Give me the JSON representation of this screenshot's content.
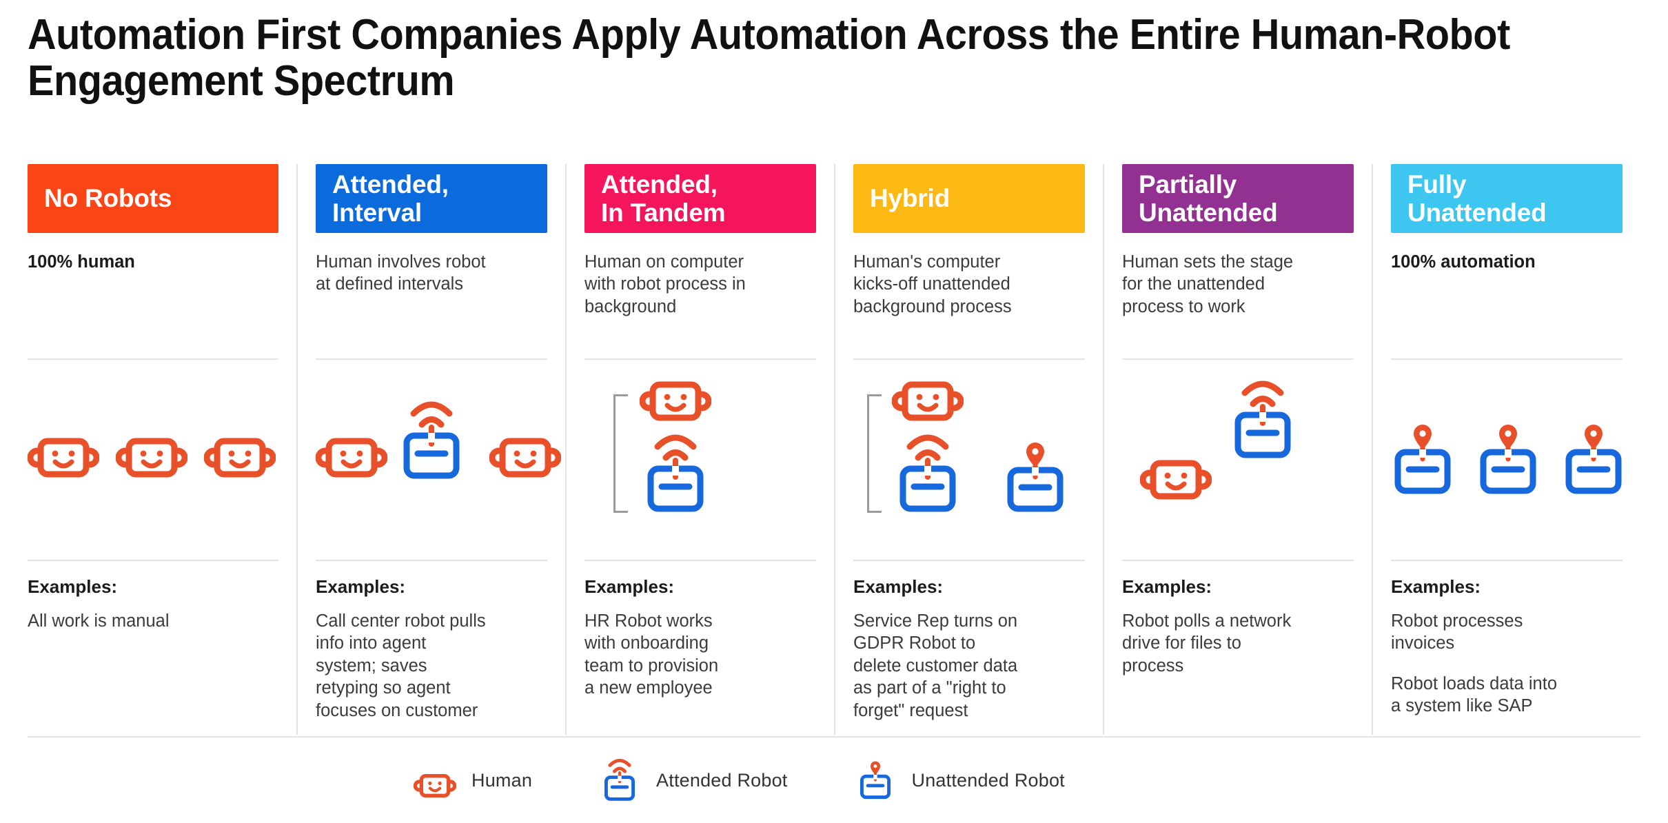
{
  "title": "Automation First Companies Apply Automation Across the Entire Human-Robot Engagement Spectrum",
  "colors": {
    "no_robots": "#FA4616",
    "attended_interval": "#0B6BDC",
    "attended_in_tandem": "#F4155D",
    "hybrid": "#FCB813",
    "partially_unattended": "#933193",
    "fully_unattended": "#3DC6F0",
    "human_icon": "#E8502A",
    "robot_icon": "#1668DC",
    "bracket": "#9b9b9b",
    "divider": "#e3e3e3",
    "text": "#3b3b3b"
  },
  "columns": [
    {
      "id": "no-robots",
      "label": "No Robots",
      "color": "#FA4616",
      "description": "100% human",
      "description_bold": true,
      "examples_label": "Examples:",
      "examples": [
        "All work is manual"
      ]
    },
    {
      "id": "attended-interval",
      "label": "Attended,\nInterval",
      "color": "#0B6BDC",
      "description": "Human involves  robot\nat defined  intervals",
      "description_bold": false,
      "examples_label": "Examples:",
      "examples": [
        "Call center robot pulls\ninfo into agent\nsystem; saves\nretyping so agent\nfocuses on customer"
      ]
    },
    {
      "id": "attended-in-tandem",
      "label": "Attended,\nIn Tandem",
      "color": "#F4155D",
      "description": "Human on computer\nwith robot process in\nbackground",
      "description_bold": false,
      "examples_label": "Examples:",
      "examples": [
        "HR Robot works\nwith onboarding\nteam to provision\na new employee"
      ]
    },
    {
      "id": "hybrid",
      "label": "Hybrid",
      "color": "#FCB813",
      "description": "Human's computer\nkicks-off unattended\nbackground process",
      "description_bold": false,
      "examples_label": "Examples:",
      "examples": [
        "Service Rep turns on\nGDPR Robot to\ndelete customer data\nas part of a \"right to\nforget\" request"
      ]
    },
    {
      "id": "partially-unattended",
      "label": "Partially\nUnattended",
      "color": "#933193",
      "description": "Human sets the stage\nfor the unattended\nprocess to work",
      "description_bold": false,
      "examples_label": "Examples:",
      "examples": [
        "Robot polls a network\ndrive for files to\nprocess"
      ]
    },
    {
      "id": "fully-unattended",
      "label": "Fully\nUnattended",
      "color": "#3DC6F0",
      "description": "100% automation",
      "description_bold": true,
      "examples_label": "Examples:",
      "examples": [
        "Robot processes\ninvoices",
        "Robot loads data into\na system like SAP"
      ]
    }
  ],
  "legend": [
    {
      "icon": "human-icon",
      "label": "Human"
    },
    {
      "icon": "attended-robot-icon",
      "label": "Attended Robot"
    },
    {
      "icon": "unattended-robot-icon",
      "label": "Unattended Robot"
    }
  ]
}
